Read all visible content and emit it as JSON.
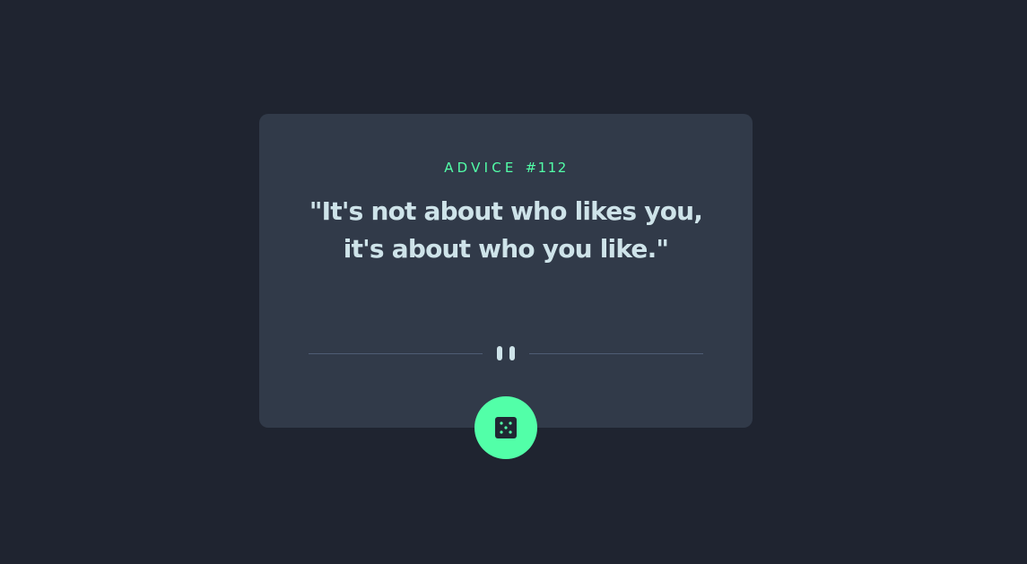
{
  "advice": {
    "label_prefix": "ADVICE",
    "id_text": "#112",
    "quote": "\"It's not about who likes you, it's about who you like.\""
  },
  "icons": {
    "pause": "pause-icon",
    "dice": "dice-icon"
  },
  "colors": {
    "background": "#1f2430",
    "card": "#313a49",
    "accent": "#52ffa8",
    "quote_text": "#cee3e9",
    "divider": "#4f5d74"
  }
}
